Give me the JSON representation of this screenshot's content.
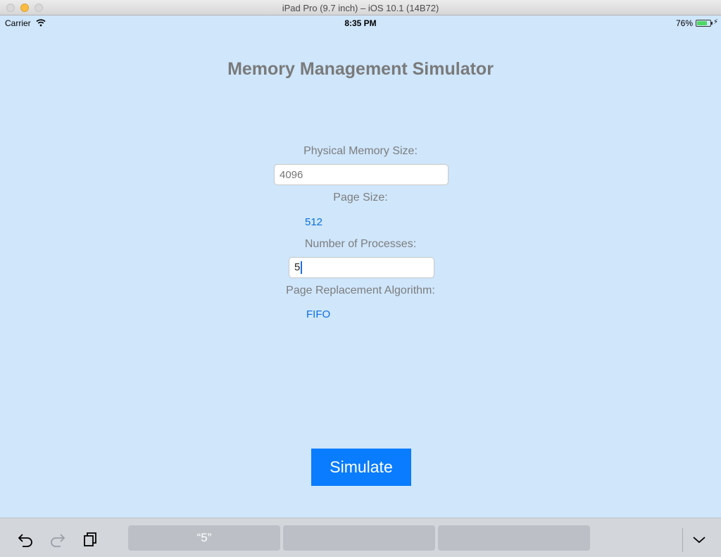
{
  "window": {
    "title": "iPad Pro (9.7 inch) – iOS 10.1 (14B72)"
  },
  "status_bar": {
    "carrier": "Carrier",
    "time": "8:35 PM",
    "battery_percent": "76%",
    "battery_level": 0.76
  },
  "app": {
    "title": "Memory Management Simulator",
    "physical_memory": {
      "label": "Physical Memory Size:",
      "placeholder": "4096"
    },
    "page_size": {
      "label": "Page Size:",
      "value": "512"
    },
    "processes": {
      "label": "Number of Processes:",
      "value": "5"
    },
    "algorithm": {
      "label": "Page Replacement Algorithm:",
      "value": "FIFO"
    },
    "simulate_label": "Simulate"
  },
  "keyboard_bar": {
    "suggestions": [
      "“5”",
      "",
      ""
    ],
    "icons": [
      "undo-icon",
      "redo-icon",
      "paste-icon",
      "chevron-down-icon"
    ]
  }
}
